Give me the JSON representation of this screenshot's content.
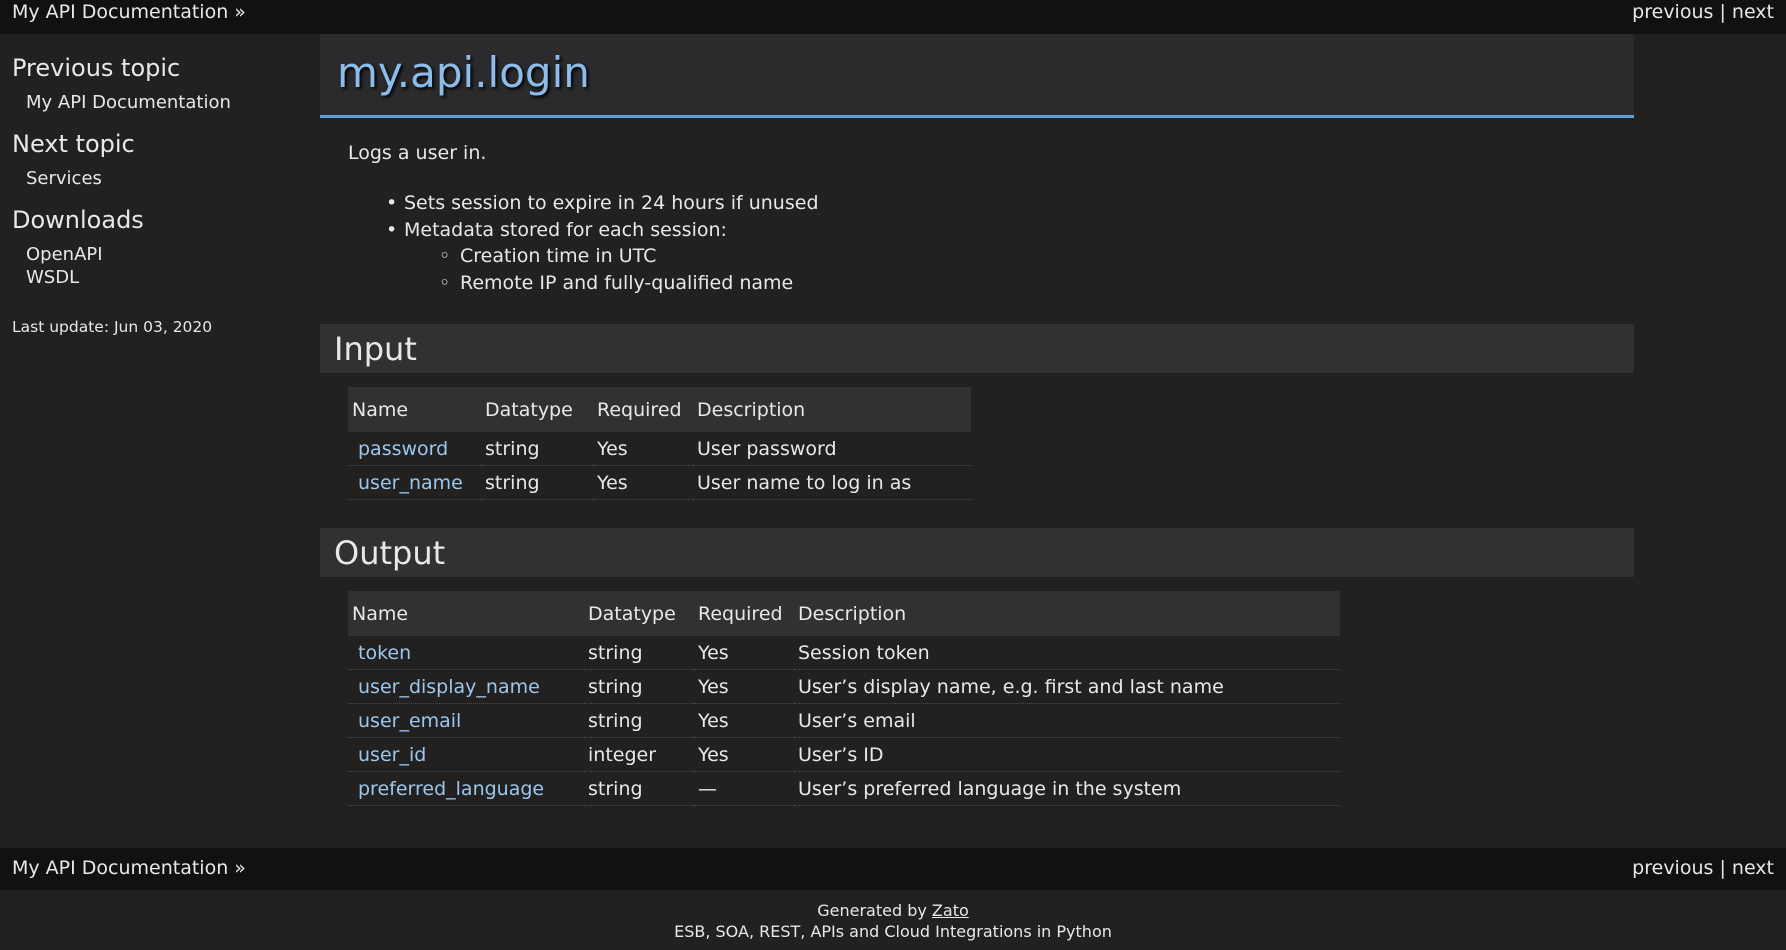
{
  "topbar": {
    "home_link": "My API Documentation",
    "breadcrumb_suffix": "»",
    "previous": "previous",
    "separator": "|",
    "next": "next"
  },
  "sidebar": {
    "previous_heading": "Previous topic",
    "previous_link": "My API Documentation",
    "next_heading": "Next topic",
    "next_link": "Services",
    "downloads_heading": "Downloads",
    "downloads": [
      "OpenAPI",
      "WSDL"
    ],
    "last_update": "Last update: Jun 03, 2020"
  },
  "page": {
    "title": "my.api.login",
    "summary": "Logs a user in.",
    "bullets": {
      "b1": "Sets session to expire in 24 hours if unused",
      "b2": "Metadata stored for each session:",
      "b2_1": "Creation time in UTC",
      "b2_2": "Remote IP and fully-qualified name"
    }
  },
  "input": {
    "heading": "Input",
    "columns": [
      "Name",
      "Datatype",
      "Required",
      "Description"
    ],
    "rows": [
      {
        "name": "password",
        "datatype": "string",
        "required": "Yes",
        "description": "User password"
      },
      {
        "name": "user_name",
        "datatype": "string",
        "required": "Yes",
        "description": "User name to log in as"
      }
    ]
  },
  "output": {
    "heading": "Output",
    "columns": [
      "Name",
      "Datatype",
      "Required",
      "Description"
    ],
    "rows": [
      {
        "name": "token",
        "datatype": "string",
        "required": "Yes",
        "description": "Session token"
      },
      {
        "name": "user_display_name",
        "datatype": "string",
        "required": "Yes",
        "description": "User’s display name, e.g. first and last name"
      },
      {
        "name": "user_email",
        "datatype": "string",
        "required": "Yes",
        "description": "User’s email"
      },
      {
        "name": "user_id",
        "datatype": "integer",
        "required": "Yes",
        "description": "User’s ID"
      },
      {
        "name": "preferred_language",
        "datatype": "string",
        "required": "—",
        "description": "User’s preferred language in the system"
      }
    ]
  },
  "footer": {
    "generated_by": "Generated by",
    "generator_link": "Zato",
    "tagline": "ESB, SOA, REST, APIs and Cloud Integrations in Python"
  },
  "colors": {
    "background": "#222120",
    "bar": "#111111",
    "title": "#8cbcea",
    "link": "#9bc7ee",
    "accent_line": "#5f9dd8"
  }
}
